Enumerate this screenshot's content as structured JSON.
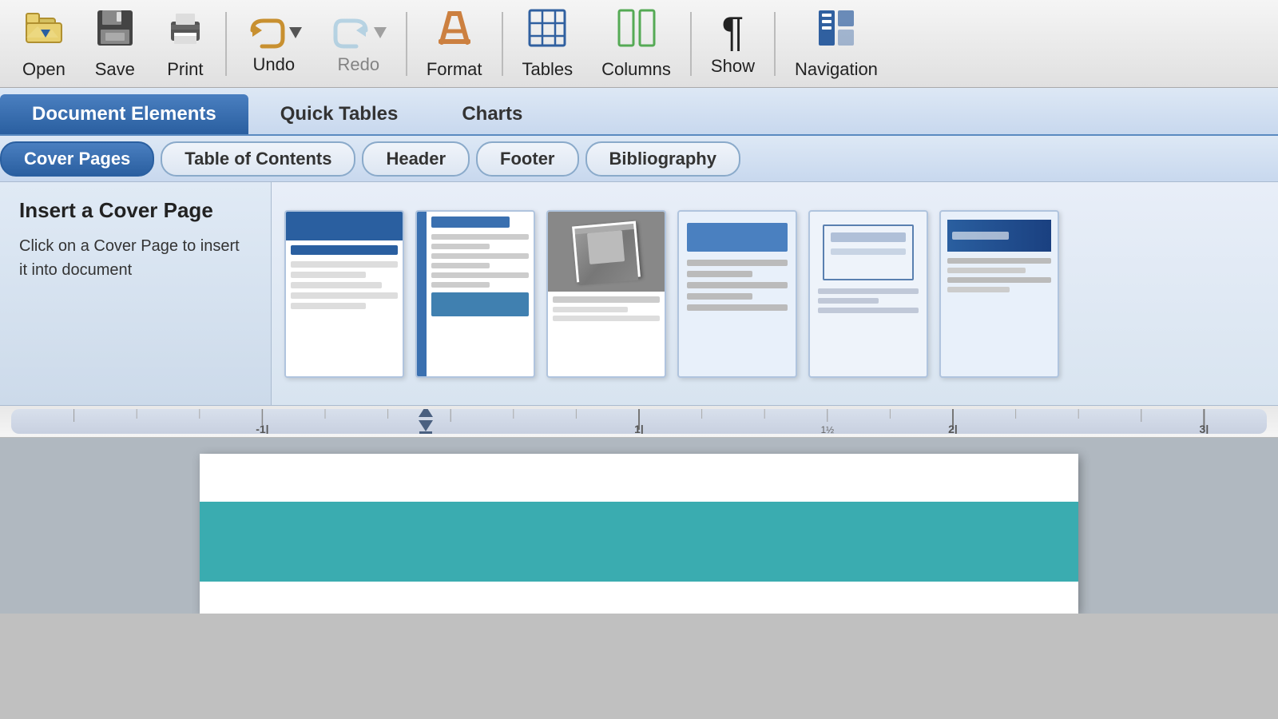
{
  "toolbar": {
    "items": [
      {
        "id": "open",
        "label": "Open",
        "icon": "📁"
      },
      {
        "id": "save",
        "label": "Save",
        "icon": "💾"
      },
      {
        "id": "print",
        "label": "Print",
        "icon": "🖨"
      },
      {
        "id": "undo",
        "label": "Undo",
        "icon": "↩",
        "hasArrow": true
      },
      {
        "id": "redo",
        "label": "Redo",
        "icon": "↪",
        "hasArrow": true
      },
      {
        "id": "format",
        "label": "Format",
        "icon": "🖊"
      },
      {
        "id": "tables",
        "label": "Tables",
        "icon": "⊞"
      },
      {
        "id": "columns",
        "label": "Columns",
        "icon": "⫢"
      },
      {
        "id": "show",
        "label": "Show",
        "icon": "¶"
      },
      {
        "id": "navigation",
        "label": "Navigation",
        "icon": "🗂"
      }
    ]
  },
  "ribbon": {
    "tabs": [
      {
        "id": "document-elements",
        "label": "Document Elements",
        "active": true
      },
      {
        "id": "quick-tables",
        "label": "Quick Tables",
        "active": false
      },
      {
        "id": "charts",
        "label": "Charts",
        "active": false
      }
    ],
    "subtabs": [
      {
        "id": "cover-pages",
        "label": "Cover Pages",
        "active": true
      },
      {
        "id": "table-of-contents",
        "label": "Table of Contents",
        "active": false
      },
      {
        "id": "header",
        "label": "Header",
        "active": false
      },
      {
        "id": "footer",
        "label": "Footer",
        "active": false
      },
      {
        "id": "bibliography",
        "label": "Bibliography",
        "active": false
      }
    ]
  },
  "content": {
    "left_panel": {
      "title": "Insert a Cover Page",
      "description": "Click on a Cover Page to insert it into document"
    },
    "templates": [
      {
        "id": "template-1",
        "style": "blue-header"
      },
      {
        "id": "template-2",
        "style": "sidebar-blue"
      },
      {
        "id": "template-3",
        "style": "photo"
      },
      {
        "id": "template-4",
        "style": "blue-box"
      },
      {
        "id": "template-5",
        "style": "bordered"
      },
      {
        "id": "template-6",
        "style": "dark-header"
      }
    ]
  },
  "ruler": {
    "numbers": [
      "-1|",
      "1|",
      "1½",
      "2|",
      "3|"
    ]
  },
  "document": {
    "teal_bar_color": "#3aacb0"
  }
}
